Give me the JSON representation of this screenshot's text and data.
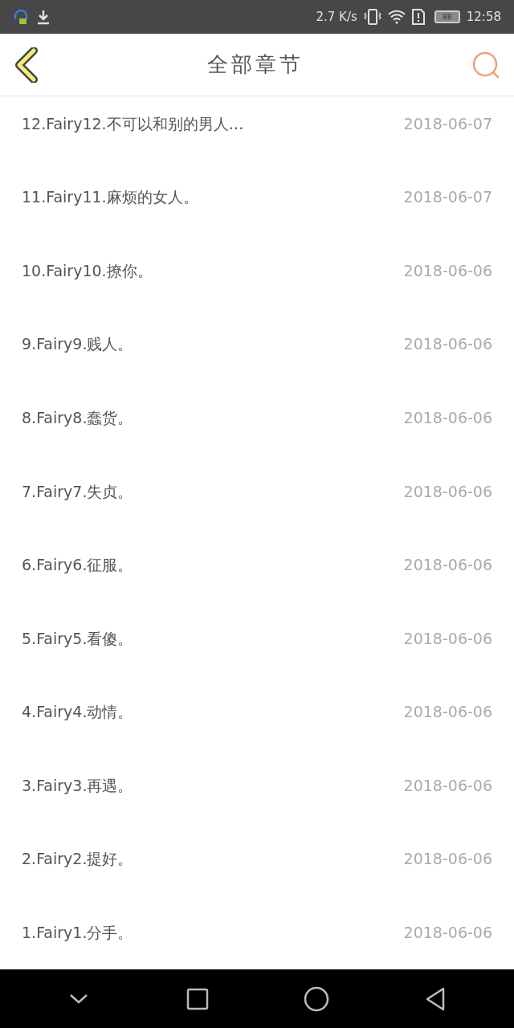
{
  "status_bar": {
    "speed": "2.7 K/s",
    "battery": "88",
    "time": "12:58"
  },
  "header": {
    "title": "全部章节"
  },
  "chapters": [
    {
      "title": "12.Fairy12.不可以和别的男人…",
      "date": "2018-06-07"
    },
    {
      "title": "11.Fairy11.麻烦的女人。",
      "date": "2018-06-07"
    },
    {
      "title": "10.Fairy10.撩你。",
      "date": "2018-06-06"
    },
    {
      "title": "9.Fairy9.贱人。",
      "date": "2018-06-06"
    },
    {
      "title": "8.Fairy8.蠢货。",
      "date": "2018-06-06"
    },
    {
      "title": "7.Fairy7.失贞。",
      "date": "2018-06-06"
    },
    {
      "title": "6.Fairy6.征服。",
      "date": "2018-06-06"
    },
    {
      "title": "5.Fairy5.看傻。",
      "date": "2018-06-06"
    },
    {
      "title": "4.Fairy4.动情。",
      "date": "2018-06-06"
    },
    {
      "title": "3.Fairy3.再遇。",
      "date": "2018-06-06"
    },
    {
      "title": "2.Fairy2.提好。",
      "date": "2018-06-06"
    },
    {
      "title": "1.Fairy1.分手。",
      "date": "2018-06-06"
    }
  ]
}
